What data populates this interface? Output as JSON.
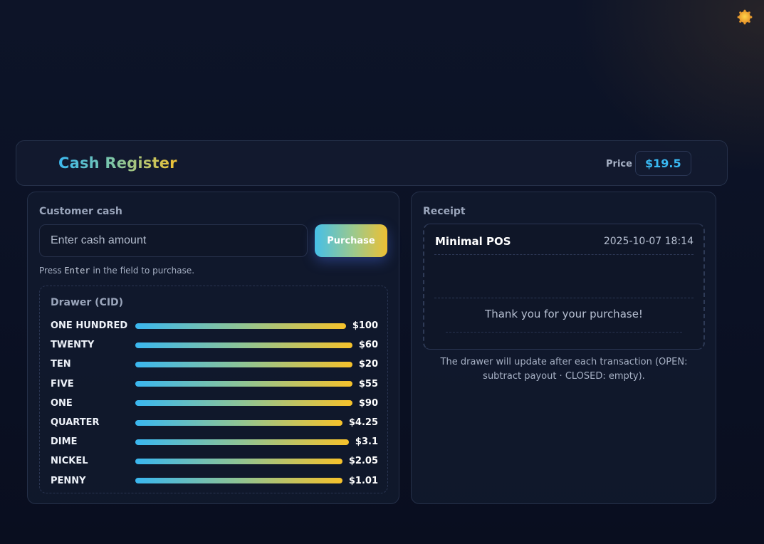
{
  "theme_toggle": {
    "icon": "sun-icon"
  },
  "header": {
    "title": "Cash Register",
    "price_label": "Price",
    "price_value": "$19.5"
  },
  "customer": {
    "label": "Customer cash",
    "input_placeholder": "Enter cash amount",
    "input_value": "",
    "purchase_label": "Purchase",
    "hint_prefix": "Press ",
    "hint_key": "Enter",
    "hint_suffix": " in the field to purchase."
  },
  "drawer": {
    "title": "Drawer (CID)",
    "rows": [
      {
        "name": "ONE HUNDRED",
        "amount": "$100",
        "level": 0.96
      },
      {
        "name": "TWENTY",
        "amount": "$60",
        "level": 0.98
      },
      {
        "name": "TEN",
        "amount": "$20",
        "level": 0.98
      },
      {
        "name": "FIVE",
        "amount": "$55",
        "level": 0.98
      },
      {
        "name": "ONE",
        "amount": "$90",
        "level": 0.98
      },
      {
        "name": "QUARTER",
        "amount": "$4.25",
        "level": 0.98
      },
      {
        "name": "DIME",
        "amount": "$3.1",
        "level": 0.98
      },
      {
        "name": "NICKEL",
        "amount": "$2.05",
        "level": 0.98
      },
      {
        "name": "PENNY",
        "amount": "$1.01",
        "level": 0.98
      }
    ]
  },
  "receipt": {
    "label": "Receipt",
    "store": "Minimal POS",
    "datetime": "2025-10-07 18:14",
    "thanks": "Thank you for your purchase!",
    "note": "The drawer will update after each transaction (OPEN: subtract payout · CLOSED: empty)."
  },
  "colors": {
    "accent_blue": "#39b9f2",
    "accent_gold": "#f1c232",
    "background": "#0b1124"
  }
}
